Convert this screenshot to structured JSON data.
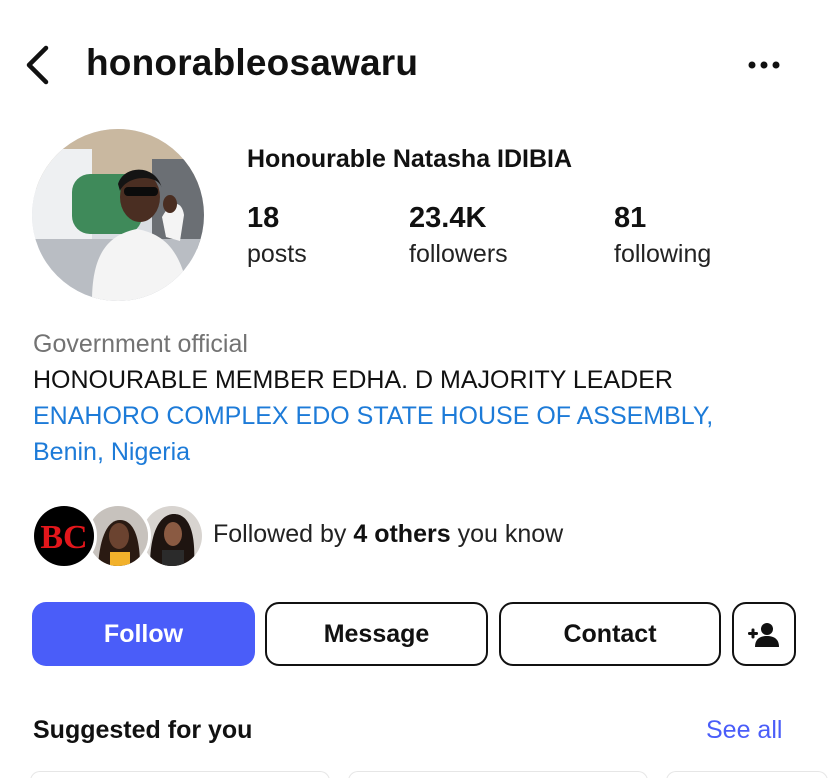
{
  "header": {
    "username": "honorableosawaru",
    "back_icon": "chevron-left-icon",
    "more_icon": "more-horizontal-icon"
  },
  "profile": {
    "display_name": "Honourable Natasha IDIBIA",
    "stats": {
      "posts": {
        "value": "18",
        "label": "posts"
      },
      "followers": {
        "value": "23.4K",
        "label": "followers"
      },
      "following": {
        "value": "81",
        "label": "following"
      }
    },
    "category": "Government official",
    "bio": "HONOURABLE MEMBER EDHA. D MAJORITY LEADER",
    "address_line1": "ENAHORO COMPLEX EDO STATE HOUSE OF ASSEMBLY,",
    "address_line2": "Benin, Nigeria"
  },
  "followed_by": {
    "prefix": "Followed by ",
    "highlight": "4 others",
    "suffix": " you know",
    "logo_text": "BC"
  },
  "actions": {
    "follow": "Follow",
    "message": "Message",
    "contact": "Contact",
    "add_user_icon": "person-add-icon"
  },
  "suggested": {
    "title": "Suggested for you",
    "see_all": "See all"
  },
  "colors": {
    "accent": "#4a5df9",
    "link": "#1d7bd8",
    "muted": "#737373",
    "logo_red": "#e3161b"
  }
}
